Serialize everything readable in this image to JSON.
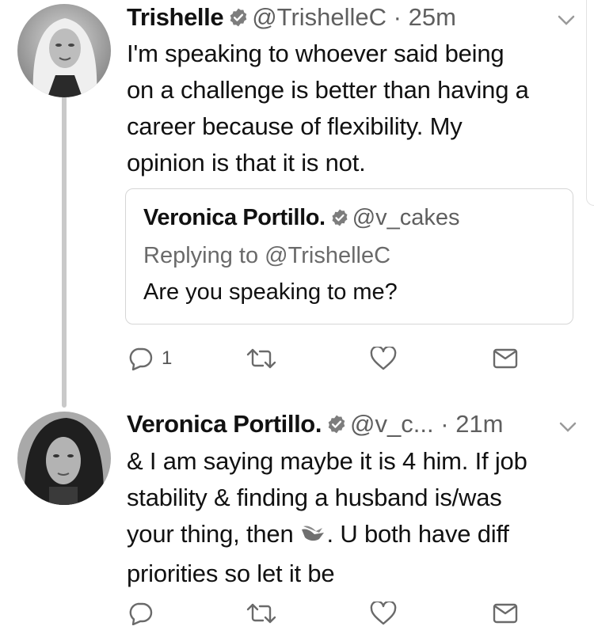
{
  "tweets": [
    {
      "display_name": "Trishelle",
      "handle": "@TrishelleC",
      "separator": "·",
      "time": "25m",
      "text_lines": [
        "I'm speaking to whoever said being",
        "on a challenge is better than having a",
        "career because of flexibility. My",
        "opinion is that it is not."
      ],
      "quoted": {
        "display_name": "Veronica Portillo.",
        "handle": "@v_cakes",
        "replying_to": "Replying to @TrishelleC",
        "text": "Are you speaking to me?"
      },
      "actions": {
        "reply_count": "1"
      }
    },
    {
      "display_name": "Veronica Portillo.",
      "handle": "@v_c...",
      "separator": "·",
      "time": "21m",
      "text_lines": [
        "& I am saying maybe it is 4 him. If job",
        "stability & finding a husband is/was",
        "your thing, then",
        ". U both have diff",
        "priorities so let it be"
      ],
      "emoji": "shrug-hands-emoji"
    }
  ],
  "icons": [
    "verified-icon",
    "caret-down-icon",
    "reply-icon",
    "retweet-icon",
    "like-icon",
    "message-icon"
  ]
}
